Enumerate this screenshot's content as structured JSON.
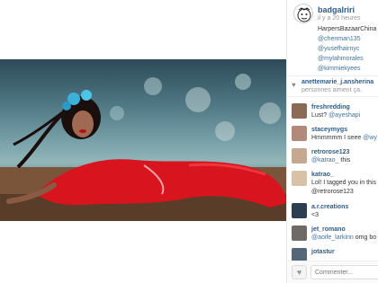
{
  "post": {
    "username": "badgalriri",
    "time": "il y a 20 heures",
    "caption_lines": [
      "HarpersBazaarChina",
      "@chenman135",
      "@yusefhairnyc",
      "@mylahmorales",
      "@kimmiekyees"
    ]
  },
  "likes": {
    "name": "anettemarie_j.ansherina",
    "tail": "personnes aiment ça."
  },
  "comments": [
    {
      "user": "freshredding",
      "text": "Lust? ",
      "mention": "@ayeshapi",
      "color": "#8a6b55"
    },
    {
      "user": "staceymygs",
      "text": "Hmmmmm I seee ",
      "mention": "@wy",
      "color": "#b18a7a"
    },
    {
      "user": "retrorose123",
      "text": "",
      "mention": "@katrao_",
      "text_after": " this",
      "color": "#c4a890"
    },
    {
      "user": "katrao_",
      "text": "Lol! I tagged you in this",
      "mention": "",
      "color": "#d7c1a7"
    },
    {
      "user": "",
      "text": "",
      "mention": "@retrorose123",
      "color": ""
    },
    {
      "user": "a.r.creations",
      "text": "<3",
      "mention": "",
      "color": "#2c3e50"
    },
    {
      "user": "jet_romano",
      "text": "",
      "mention": "@aoife_larkinn",
      "text_after": " omg bo",
      "color": "#6f6a66"
    },
    {
      "user": "jotastur",
      "text": "",
      "mention": "",
      "color": "#556677"
    }
  ],
  "footer": {
    "comment_placeholder": "Commenter..."
  },
  "colors": {
    "link": "#3f729b",
    "username": "#2d5b87",
    "dress_red": "#d8141e"
  }
}
